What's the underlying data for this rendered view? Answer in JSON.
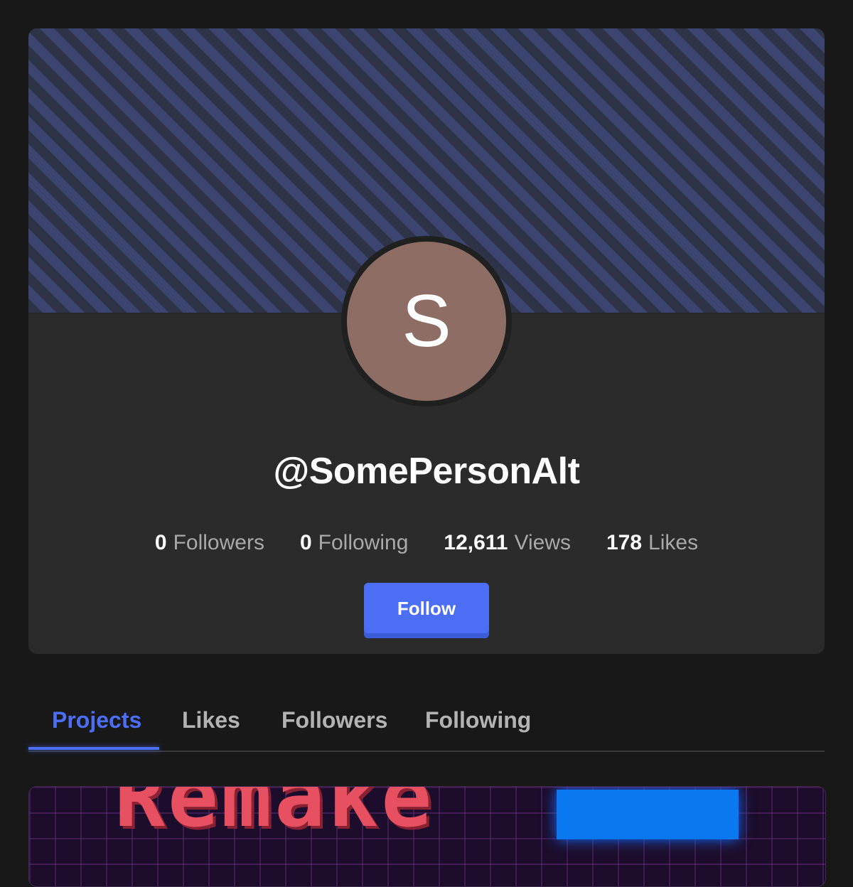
{
  "profile": {
    "avatar_letter": "S",
    "avatar_color": "#8e6d64",
    "username": "@SomePersonAlt",
    "follow_label": "Follow",
    "accent_color": "#4c6ef5"
  },
  "stats": [
    {
      "num": "0",
      "label": "Followers"
    },
    {
      "num": "0",
      "label": "Following"
    },
    {
      "num": "12,611",
      "label": "Views"
    },
    {
      "num": "178",
      "label": "Likes"
    }
  ],
  "tabs": [
    {
      "label": "Projects",
      "active": true
    },
    {
      "label": "Likes",
      "active": false
    },
    {
      "label": "Followers",
      "active": false
    },
    {
      "label": "Following",
      "active": false
    }
  ],
  "projects": [
    {
      "thumbnail_text": "Remake"
    }
  ]
}
